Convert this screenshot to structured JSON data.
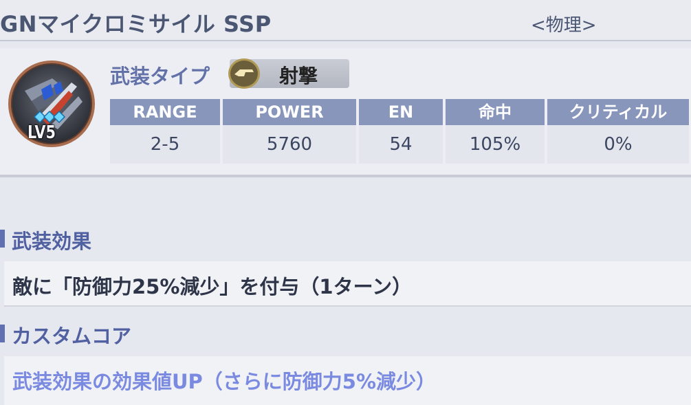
{
  "weapon": {
    "name": "GNマイクロミサイル SSP",
    "attribute": "<物理>",
    "level_badge": "LV5",
    "type_label": "武装タイプ",
    "type_value": "射撃"
  },
  "stats": {
    "columns": [
      {
        "head": "RANGE",
        "value": "2-5"
      },
      {
        "head": "POWER",
        "value": "5760"
      },
      {
        "head": "EN",
        "value": "54"
      },
      {
        "head": "命中",
        "value": "105%"
      },
      {
        "head": "クリティカル",
        "value": "0%"
      }
    ]
  },
  "sections": {
    "weapon_effect": {
      "title": "武装効果",
      "text": "敵に「防御力25%減少」を付与（1ターン）"
    },
    "custom_core": {
      "title": "カスタムコア",
      "text": "武装効果の効果値UP（さらに防御力5%減少）"
    }
  },
  "colors": {
    "title_text": "#4a5672",
    "section_title": "#5060a0",
    "table_header_bg": "#8896bc",
    "core_text": "#7a8ae0",
    "effect_text": "#2e3548"
  },
  "icons": {
    "weapon": "missile-pod-icon",
    "type": "shooting-icon",
    "upgrade": "crystal-upgrade-icon"
  }
}
